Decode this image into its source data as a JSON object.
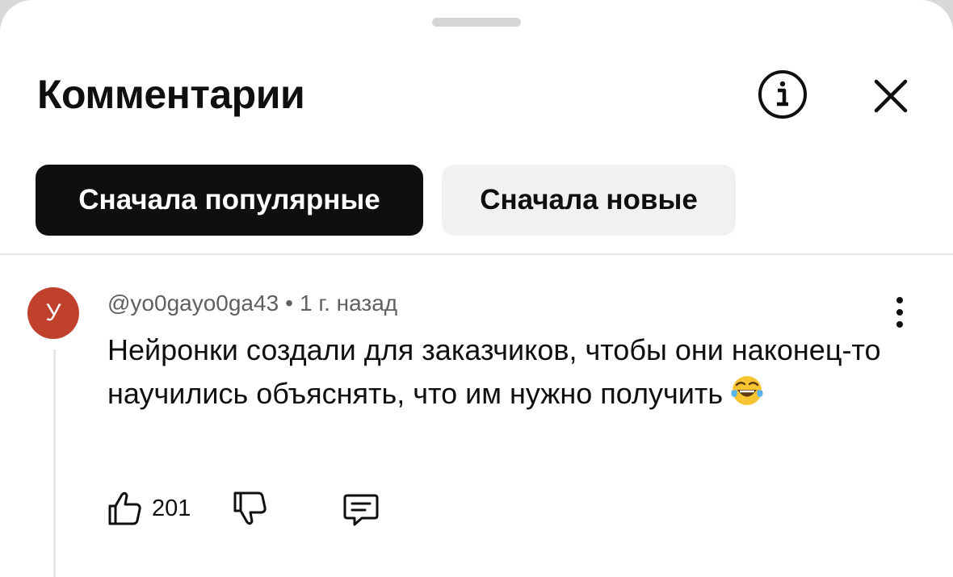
{
  "header": {
    "title": "Комментарии",
    "info_icon": "info-icon",
    "close_icon": "close-icon"
  },
  "sort_chips": [
    {
      "label": "Сначала популярные",
      "active": true
    },
    {
      "label": "Сначала новые",
      "active": false
    }
  ],
  "comment": {
    "avatar_letter": "У",
    "avatar_color": "#c0412b",
    "author": "@yo0gayo0ga43",
    "separator": "•",
    "time": "1 г. назад",
    "text": "Нейронки создали для заказчиков, чтобы они наконец-то научились объяснять, что им нужно получить",
    "emoji": "face-with-tears-of-joy",
    "likes": "201",
    "icons": {
      "like": "thumbs-up-icon",
      "dislike": "thumbs-down-icon",
      "reply": "reply-comment-icon",
      "more": "more-vertical-icon"
    }
  }
}
